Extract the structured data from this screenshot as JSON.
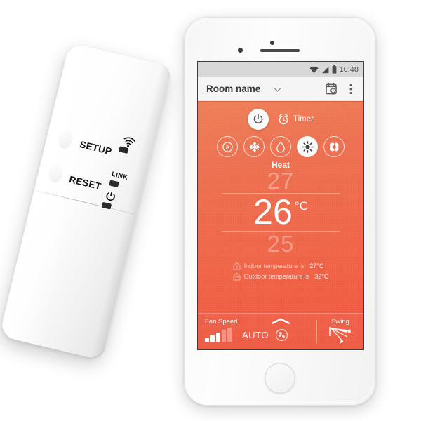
{
  "scene": {
    "description": "Smart AC WiFi controller module beside a white smartphone running an air-conditioner remote app"
  },
  "device": {
    "name": "wifi-adapter",
    "buttons": [
      {
        "id": "setup",
        "label": "SETUP"
      },
      {
        "id": "reset",
        "label": "RESET"
      }
    ],
    "indicators": [
      {
        "id": "wifi",
        "label": "",
        "icon": "wifi-icon"
      },
      {
        "id": "link",
        "label": "LINK",
        "icon": "led-indicator"
      },
      {
        "id": "power",
        "label": "",
        "icon": "power-icon"
      }
    ]
  },
  "phone": {
    "statusbar": {
      "time": "10:48",
      "icons": [
        "wifi-icon",
        "signal-icon",
        "battery-icon"
      ]
    },
    "appbar": {
      "title": "Room name",
      "dropdown_icon": "chevron-down-icon",
      "schedule_icon": "schedule-icon",
      "overflow_icon": "overflow-menu-icon"
    },
    "navbar": {
      "back": "back-icon",
      "home": "home-icon",
      "recents": "recents-icon"
    }
  },
  "app": {
    "power": {
      "icon": "power-icon",
      "state": "on"
    },
    "timer": {
      "label": "Timer",
      "icon": "alarm-clock-icon"
    },
    "modes": [
      {
        "id": "auto",
        "icon": "auto-mode-icon",
        "active": false
      },
      {
        "id": "cool",
        "icon": "snowflake-icon",
        "active": false
      },
      {
        "id": "dry",
        "icon": "water-drop-icon",
        "active": false
      },
      {
        "id": "heat",
        "icon": "sun-icon",
        "active": true
      },
      {
        "id": "fan",
        "icon": "fan-icon",
        "active": false
      }
    ],
    "mode_name": "Heat",
    "temperature": {
      "above": "27",
      "current": "26",
      "unit": "°C",
      "below": "25"
    },
    "readings": [
      {
        "icon": "indoor-house-icon",
        "text": "Indoor temperature is",
        "value": "27°C"
      },
      {
        "icon": "outdoor-house-icon",
        "text": "Outdoor temperature is",
        "value": "32°C"
      }
    ],
    "controls": {
      "fan_speed_label": "Fan Speed",
      "fan_mode": "AUTO",
      "fan_level_filled": 3,
      "fan_level_total": 5,
      "fan_icon": "fan-circle-icon",
      "swing_label": "Swing",
      "swing_icon": "swing-arrow-icon",
      "drawer_handle_icon": "chevron-up-icon"
    }
  },
  "colors": {
    "accent_top": "#ee8058",
    "accent_bottom": "#f05c42",
    "control_bar": "#ee5c44",
    "appbar_bg": "#f5f5f5",
    "statusbar_bg": "#d8d8d8",
    "navbar_bg": "#0b0b0b",
    "text_on_accent": "#ffffff"
  }
}
